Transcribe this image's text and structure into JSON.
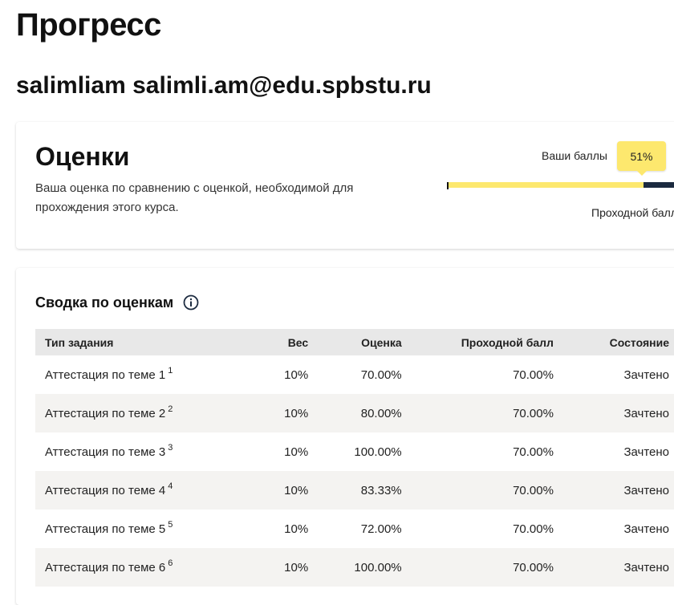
{
  "page": {
    "title": "Прогресс",
    "user_line": "salimliam salimli.am@edu.spbstu.ru"
  },
  "grades": {
    "title": "Оценки",
    "description": "Ваша оценка по сравнению с оценкой, необходимой для прохождения этого курса.",
    "your_score_label": "Ваши баллы",
    "your_score_value": "51%",
    "your_score_fraction": 0.51,
    "passing_label": "Проходной балл",
    "colors": {
      "fill": "#fde86e",
      "track": "#1b2a3f"
    }
  },
  "summary": {
    "title": "Сводка по оценкам",
    "info_icon": "info-circle-icon",
    "columns": [
      "Тип задания",
      "Вес",
      "Оценка",
      "Проходной балл",
      "Состояние"
    ],
    "rows": [
      {
        "type": "Аттестация по теме 1",
        "footnote": "1",
        "weight": "10%",
        "grade": "70.00%",
        "passing": "70.00%",
        "state": "Зачтено"
      },
      {
        "type": "Аттестация по теме 2",
        "footnote": "2",
        "weight": "10%",
        "grade": "80.00%",
        "passing": "70.00%",
        "state": "Зачтено"
      },
      {
        "type": "Аттестация по теме 3",
        "footnote": "3",
        "weight": "10%",
        "grade": "100.00%",
        "passing": "70.00%",
        "state": "Зачтено"
      },
      {
        "type": "Аттестация по теме 4",
        "footnote": "4",
        "weight": "10%",
        "grade": "83.33%",
        "passing": "70.00%",
        "state": "Зачтено"
      },
      {
        "type": "Аттестация по теме 5",
        "footnote": "5",
        "weight": "10%",
        "grade": "72.00%",
        "passing": "70.00%",
        "state": "Зачтено"
      },
      {
        "type": "Аттестация по теме 6",
        "footnote": "6",
        "weight": "10%",
        "grade": "100.00%",
        "passing": "70.00%",
        "state": "Зачтено"
      }
    ]
  }
}
